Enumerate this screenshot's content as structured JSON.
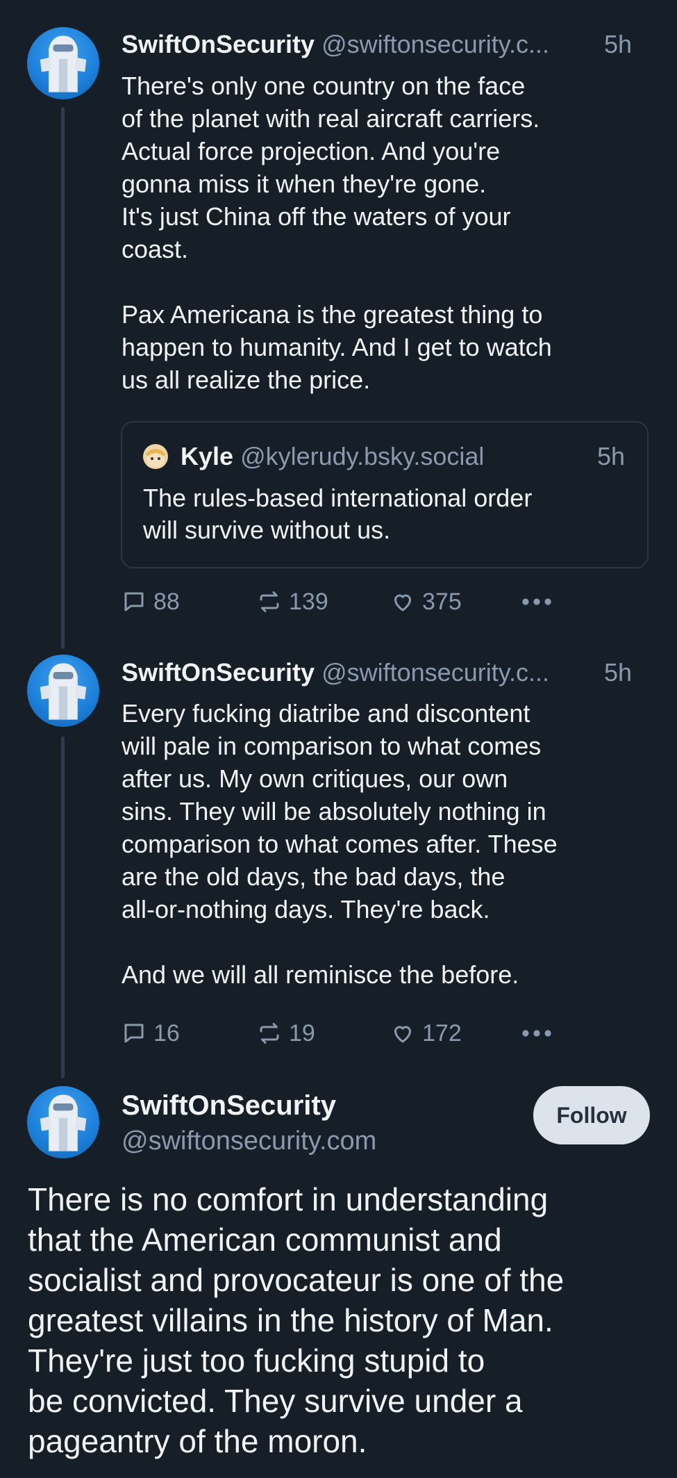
{
  "posts": [
    {
      "name": "SwiftOnSecurity",
      "handle": "@swiftonsecurity.c...",
      "time": "5h",
      "text": "There's only one country on the face\nof the planet with real aircraft carriers.\nActual force projection. And you're\ngonna miss it when they're gone.\nIt's just China off the waters of your\ncoast.\n\nPax Americana is the greatest thing to\nhappen to humanity. And I get to watch\nus all realize the price.",
      "quote": {
        "name": "Kyle",
        "handle": "@kylerudy.bsky.social",
        "time": "5h",
        "text": "The rules-based international order\nwill survive without us."
      },
      "replies": "88",
      "reposts": "139",
      "likes": "375"
    },
    {
      "name": "SwiftOnSecurity",
      "handle": "@swiftonsecurity.c...",
      "time": "5h",
      "text": "Every fucking diatribe and discontent\nwill pale in comparison to what comes\nafter us. My own critiques, our own\nsins. They will be absolutely nothing in\ncomparison to what comes after. These\nare the old days, the bad days, the\nall-or-nothing days. They're back.\n\nAnd we will all reminisce the before.",
      "replies": "16",
      "reposts": "19",
      "likes": "172"
    }
  ],
  "main_post": {
    "name": "SwiftOnSecurity",
    "handle": "@swiftonsecurity.com",
    "follow_label": "Follow",
    "text": "There is no comfort in understanding\nthat the American communist and\nsocialist and provocateur is one of the\ngreatest villains in the history of Man.\nThey're just too fucking stupid to\nbe convicted. They survive under a\npageantry of the moron."
  },
  "icons": [
    "reply-icon",
    "repost-icon",
    "like-icon",
    "more-icon"
  ],
  "colors": {
    "background": "#161e27",
    "muted": "#8a9aae",
    "text": "#f1f3f5",
    "follow_bg": "#dde3ea"
  }
}
